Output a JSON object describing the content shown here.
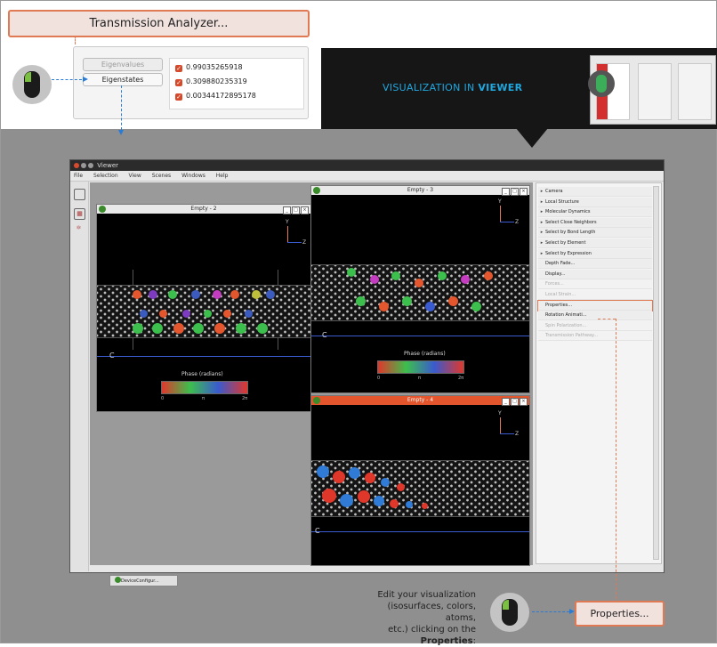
{
  "transmission_analyzer": {
    "title": "Transmission Analyzer...",
    "buttons": {
      "eigenvalues": "Eigenvalues",
      "eigenstates": "Eigenstates"
    },
    "list": [
      "0.99035265918",
      "0.309880235319",
      "0.00344172895178"
    ]
  },
  "banner": {
    "prefix": "VISUALIZATION IN ",
    "strong": "VIEWER"
  },
  "viewer": {
    "title": "Viewer",
    "menu": [
      "File",
      "Selection",
      "View",
      "Scenes",
      "Windows",
      "Help"
    ],
    "panels": {
      "p2": {
        "title": "Empty - 2"
      },
      "p3": {
        "title": "Empty - 3"
      },
      "p4": {
        "title": "Empty - 4"
      }
    },
    "phase": {
      "label": "Phase (radians)",
      "ticks": [
        "0",
        "π",
        "2π"
      ]
    },
    "axes": {
      "y": "Y",
      "z": "Z",
      "c": "C"
    },
    "taskbar": "DeviceConfigur...",
    "side_items": [
      {
        "label": "Camera",
        "expand": true,
        "enabled": true
      },
      {
        "label": "Local Structure",
        "expand": true,
        "enabled": true
      },
      {
        "label": "Molecular Dynamics",
        "expand": true,
        "enabled": true
      },
      {
        "label": "Select Close Neighbors",
        "expand": true,
        "enabled": true
      },
      {
        "label": "Select by Bond Length",
        "expand": true,
        "enabled": true
      },
      {
        "label": "Select by Element",
        "expand": true,
        "enabled": true
      },
      {
        "label": "Select by Expression",
        "expand": true,
        "enabled": true
      },
      {
        "label": "Depth Fade...",
        "expand": false,
        "enabled": true
      },
      {
        "label": "Display...",
        "expand": false,
        "enabled": true
      },
      {
        "label": "Forces...",
        "expand": false,
        "enabled": false
      },
      {
        "label": "Local Strain...",
        "expand": false,
        "enabled": false
      },
      {
        "label": "Properties...",
        "expand": false,
        "enabled": true,
        "highlight": true
      },
      {
        "label": "Rotation Animati...",
        "expand": false,
        "enabled": true
      },
      {
        "label": "Spin Polarization...",
        "expand": false,
        "enabled": false
      },
      {
        "label": "Transmission Pathway...",
        "expand": false,
        "enabled": false
      }
    ]
  },
  "instruction": {
    "line1": "Edit your visualization",
    "line2": "(isosurfaces, colors, atoms,",
    "line3": "etc.) clicking on the",
    "strong": "Properties",
    "suffix": ":"
  },
  "properties_callout": "Properties...",
  "colors": {
    "accent": "#e07a55",
    "link_blue": "#2a7bd6",
    "banner_bg": "#161616",
    "banner_text": "#1fa8e0"
  }
}
